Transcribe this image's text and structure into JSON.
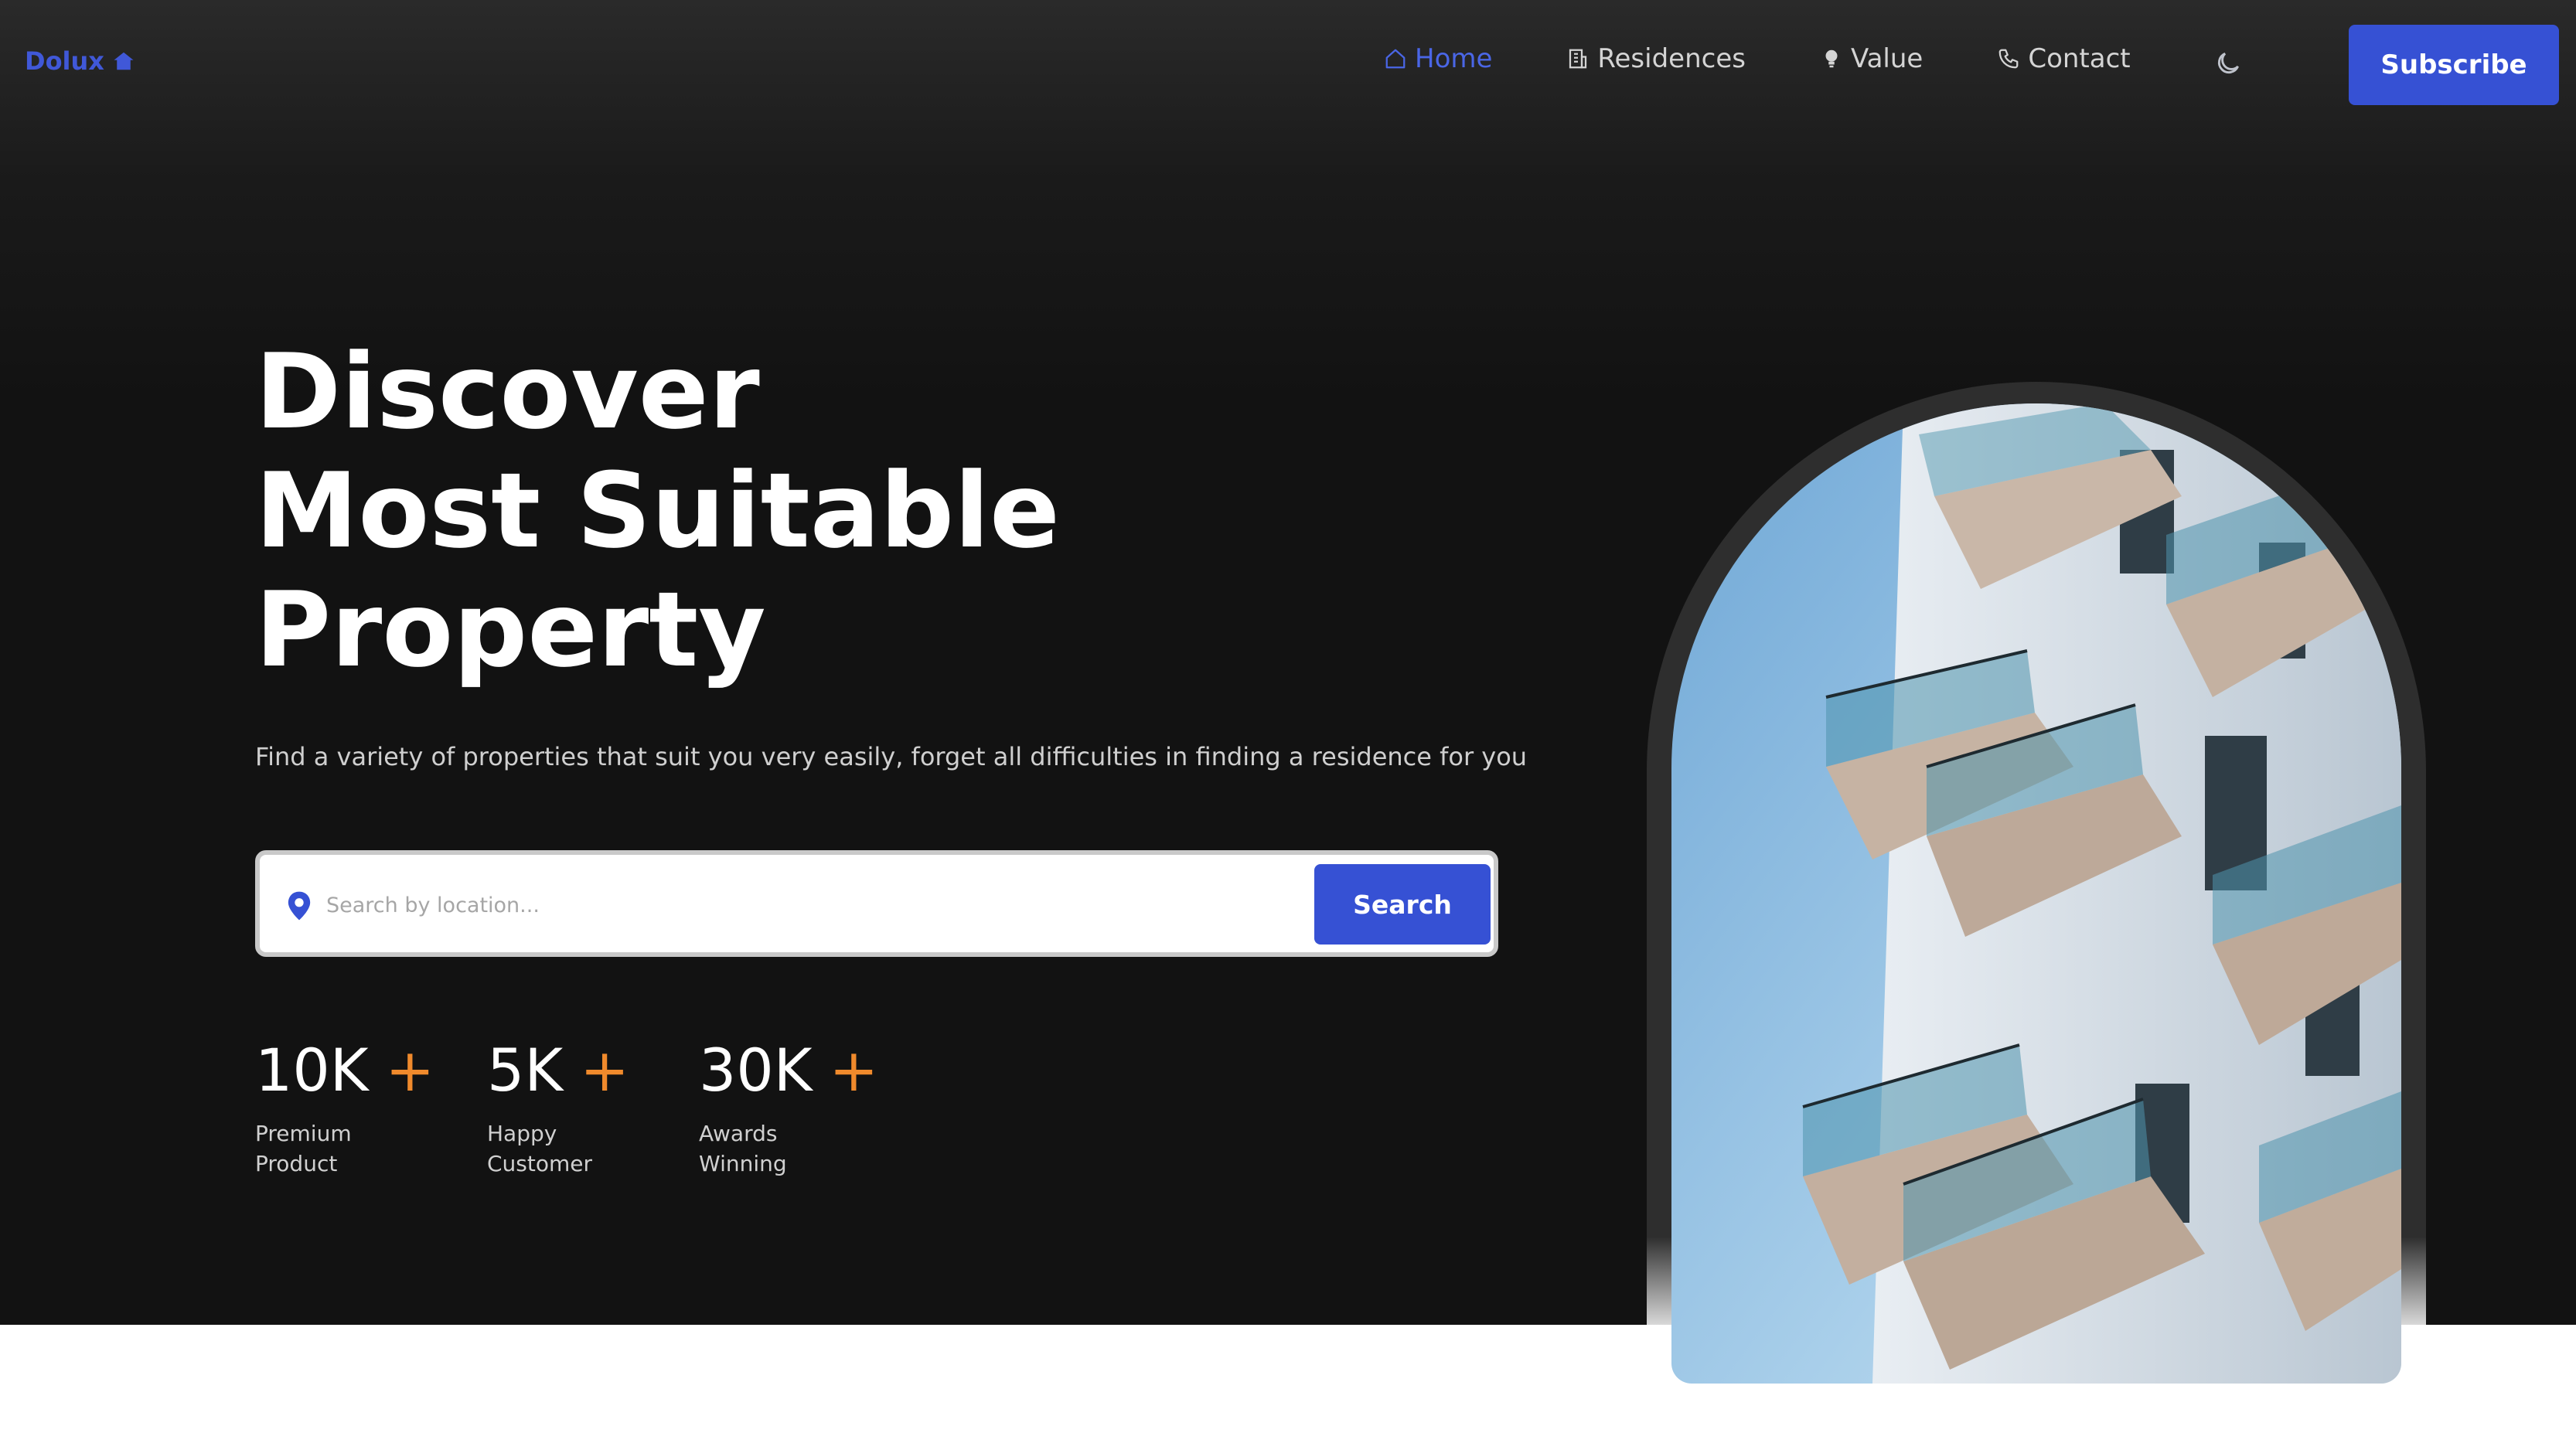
{
  "brand": {
    "name": "Dolux",
    "icon": "house-icon",
    "color": "#4058d8"
  },
  "nav": {
    "items": [
      {
        "label": "Home",
        "icon": "home-icon",
        "active": true
      },
      {
        "label": "Residences",
        "icon": "building-icon",
        "active": false
      },
      {
        "label": "Value",
        "icon": "lightbulb-icon",
        "active": false
      },
      {
        "label": "Contact",
        "icon": "phone-icon",
        "active": false
      }
    ],
    "theme_toggle_icon": "moon-icon",
    "subscribe_label": "Subscribe",
    "active_color": "#4a66e6"
  },
  "hero": {
    "headline": [
      "Discover",
      "Most Suitable",
      "Property"
    ],
    "subtitle": "Find a variety of properties that suit you very easily, forget all difficulties in finding a residence for you",
    "search": {
      "placeholder": "Search by location...",
      "value": "",
      "button_label": "Search",
      "icon": "location-pin-icon"
    },
    "stats": [
      {
        "value": "10K",
        "suffix": "+",
        "label": "Premium\nProduct"
      },
      {
        "value": "5K",
        "suffix": "+",
        "label": "Happy\nCustomer"
      },
      {
        "value": "30K",
        "suffix": "+",
        "label": "Awards\nWinning"
      }
    ],
    "image": {
      "subject": "modern-apartment-building-photo"
    }
  },
  "colors": {
    "accent": "#3651d4",
    "background": "#121212",
    "stat_plus": "#f08a2c"
  }
}
